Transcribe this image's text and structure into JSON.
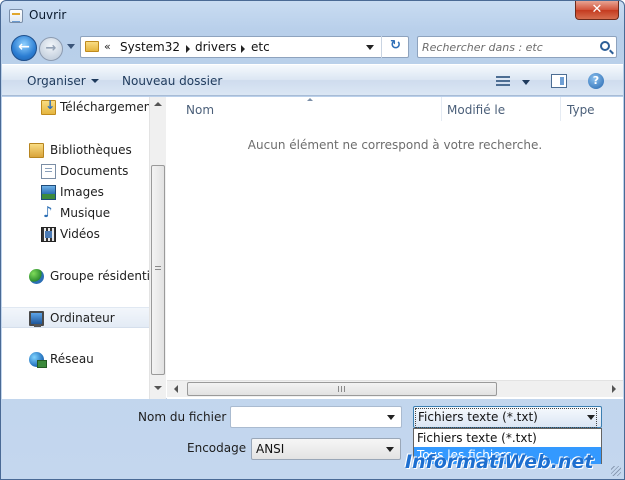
{
  "window": {
    "title": "Ouvrir",
    "close_glyph": "✕"
  },
  "nav_buttons": {
    "back_glyph": "←",
    "forward_glyph": "→"
  },
  "address": {
    "overflow": "«",
    "crumbs": [
      "System32",
      "drivers",
      "etc"
    ],
    "refresh_glyph": "↻"
  },
  "search": {
    "placeholder": "Rechercher dans : etc",
    "value": ""
  },
  "toolbar": {
    "organize_label": "Organiser",
    "new_folder_label": "Nouveau dossier",
    "help_glyph": "?"
  },
  "sidebar": {
    "items": [
      {
        "label": "Téléchargements",
        "icon": "downloads-folder-icon"
      },
      {
        "label": "Bibliothèques",
        "icon": "libraries-icon"
      },
      {
        "label": "Documents",
        "icon": "documents-icon"
      },
      {
        "label": "Images",
        "icon": "images-icon"
      },
      {
        "label": "Musique",
        "icon": "music-icon"
      },
      {
        "label": "Vidéos",
        "icon": "videos-icon"
      },
      {
        "label": "Groupe résidentiel",
        "icon": "homegroup-icon"
      },
      {
        "label": "Ordinateur",
        "icon": "computer-icon",
        "selected": true
      },
      {
        "label": "Réseau",
        "icon": "network-icon"
      }
    ]
  },
  "file_list": {
    "columns": [
      "Nom",
      "Modifié le",
      "Type"
    ],
    "empty_message": "Aucun élément ne correspond à votre recherche."
  },
  "bottom": {
    "filename_label": "Nom du fichier :",
    "filename_value": "",
    "filetype_value": "Fichiers texte (*.txt)",
    "filetype_options": [
      "Fichiers texte (*.txt)",
      "Tous les fichiers"
    ],
    "filetype_highlighted_index": 1,
    "encoding_label": "Encodage :",
    "encoding_value": "ANSI"
  },
  "watermark": "InformatiWeb.net",
  "colors": {
    "highlight": "#3399ff",
    "close_button": "#c43a1f",
    "titlebar": "#c9dcf2",
    "watermark": "#1d6fd0"
  }
}
